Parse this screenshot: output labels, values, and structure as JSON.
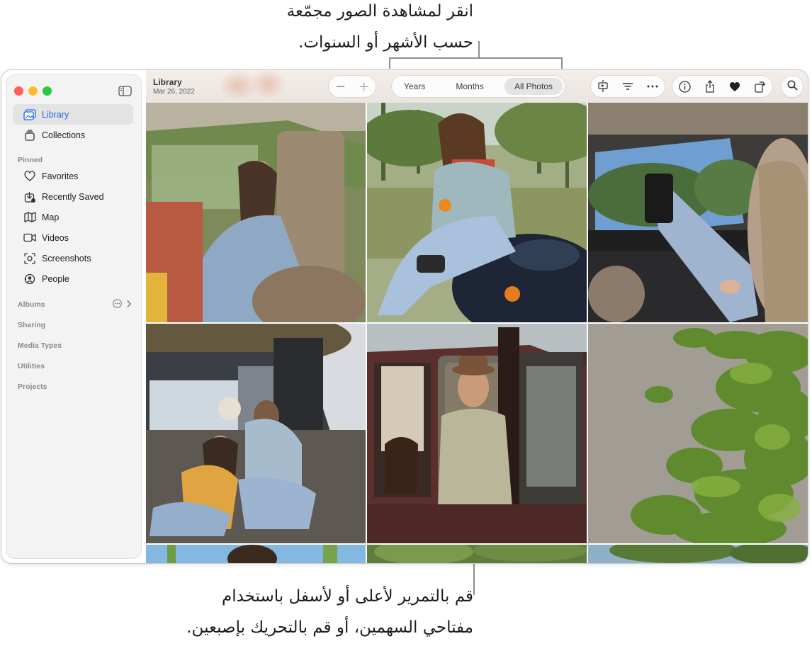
{
  "callouts": {
    "top_line1": "انقر لمشاهدة الصور مجمّعة",
    "top_line2": "حسب الأشهر أو السنوات.",
    "bottom_line1": "قم بالتمرير لأعلى أو لأسفل باستخدام",
    "bottom_line2": "مفتاحي السهمين، أو قم بالتحريك بإصبعين."
  },
  "sidebar": {
    "items": [
      {
        "label": "Library",
        "icon": "photo-library-icon"
      },
      {
        "label": "Collections",
        "icon": "collections-icon"
      }
    ],
    "pinned_header": "Pinned",
    "pinned": [
      {
        "label": "Favorites",
        "icon": "heart-icon"
      },
      {
        "label": "Recently Saved",
        "icon": "download-icon"
      },
      {
        "label": "Map",
        "icon": "map-icon"
      },
      {
        "label": "Videos",
        "icon": "video-icon"
      },
      {
        "label": "Screenshots",
        "icon": "screenshot-icon"
      },
      {
        "label": "People",
        "icon": "people-icon"
      }
    ],
    "sections": [
      "Albums",
      "Sharing",
      "Media Types",
      "Utilities",
      "Projects"
    ]
  },
  "toolbar": {
    "title": "Library",
    "date": "Mar 26, 2022",
    "zoom_out": "−",
    "zoom_in": "+",
    "segments": [
      "Years",
      "Months",
      "All Photos"
    ],
    "active_segment": "All Photos"
  },
  "colors": {
    "accent": "#1d6ae6",
    "callout_line": "#8e8e93"
  }
}
